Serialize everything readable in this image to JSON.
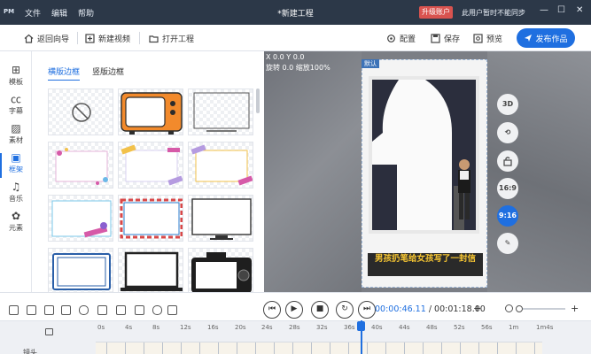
{
  "titlebar": {
    "logo": "PM",
    "menu": [
      "文件",
      "编辑",
      "帮助"
    ],
    "document_title": "*新建工程",
    "upgrade_label": "升级账户",
    "status_text": "此用户暂时不能同步",
    "minimize": "—",
    "maximize": "☐",
    "close": "✕"
  },
  "toolbar": {
    "back_label": "返回向导",
    "new_video_label": "新建视频",
    "open_project_label": "打开工程",
    "dub_label": "配置",
    "save_label": "保存",
    "preview_label": "预览",
    "publish_label": "发布作品"
  },
  "sidebar": {
    "items": [
      {
        "label": "模板",
        "icon": "template-icon",
        "glyph": "⊞"
      },
      {
        "label": "字幕",
        "icon": "subtitle-icon",
        "glyph": "㏄"
      },
      {
        "label": "素材",
        "icon": "material-icon",
        "glyph": "▨"
      },
      {
        "label": "框架",
        "icon": "frame-icon",
        "glyph": "▣",
        "active": true
      },
      {
        "label": "音乐",
        "icon": "music-icon",
        "glyph": "♫"
      },
      {
        "label": "元素",
        "icon": "element-icon",
        "glyph": "✿"
      }
    ]
  },
  "panel": {
    "tabs": [
      "横版边框",
      "竖版边框"
    ],
    "active_tab": 0
  },
  "preview": {
    "coord_x": "X 0.0 Y 0.0",
    "coord_rot": "旋转 0.0 缩放100%",
    "phone_label": "默认",
    "caption": "男孩扔笔给女孩写了一封信",
    "tools": [
      "3D",
      "⟲",
      "🔒",
      "16:9",
      "9:16",
      "✎"
    ],
    "active_tool": "9:16"
  },
  "timeline": {
    "current_time": "00:00:46.11",
    "total_time": "00:01:18.00",
    "separator": "/",
    "zoom_minus": "—",
    "zoom_plus": "+",
    "ruler_ticks": [
      "0s",
      "4s",
      "8s",
      "12s",
      "16s",
      "20s",
      "24s",
      "28s",
      "32s",
      "36s",
      "40s",
      "44s",
      "48s",
      "52s",
      "56s",
      "1m",
      "1m4s"
    ],
    "track_name": "镜头"
  },
  "colors": {
    "accent": "#1f6fe0",
    "titlebar_bg": "#2c3848",
    "upgrade_bg": "#d9534f",
    "caption_text": "#f7c632"
  }
}
